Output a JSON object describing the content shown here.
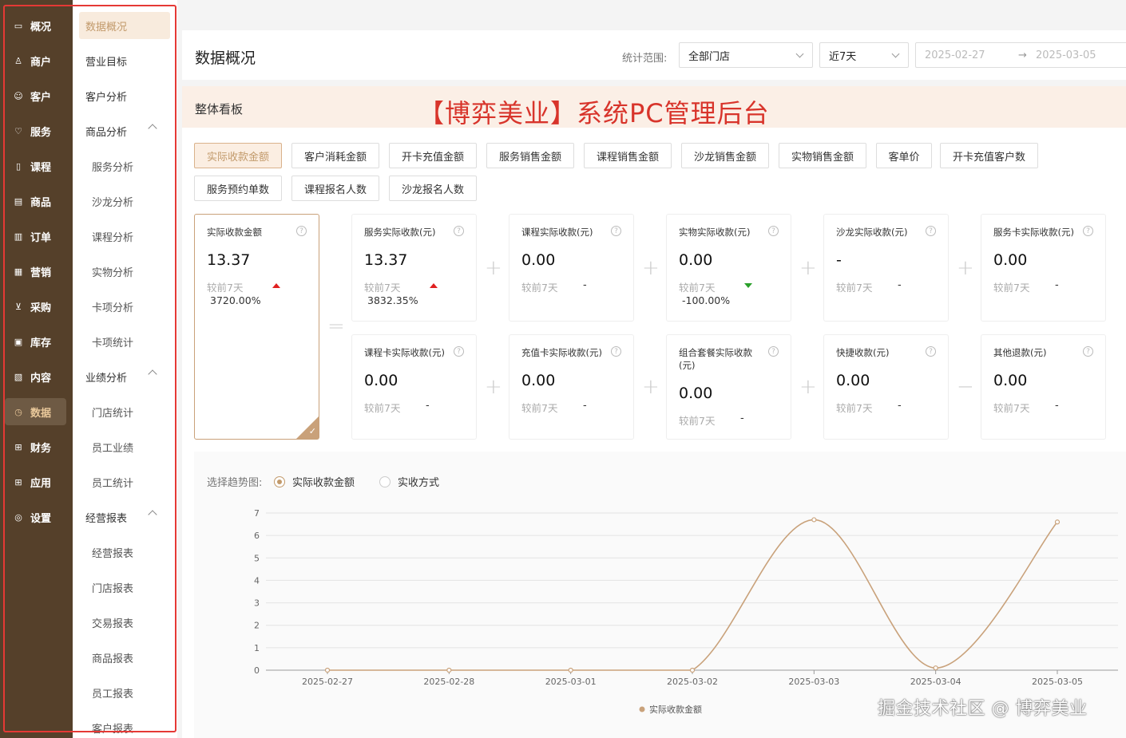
{
  "sidebar": {
    "items": [
      {
        "icon": "monitor-icon",
        "glyph": "▭",
        "label": "概况"
      },
      {
        "icon": "merchant-icon",
        "glyph": "♙",
        "label": "商户"
      },
      {
        "icon": "customer-icon",
        "glyph": "☺",
        "label": "客户"
      },
      {
        "icon": "service-icon",
        "glyph": "♡",
        "label": "服务"
      },
      {
        "icon": "course-icon",
        "glyph": "▯",
        "label": "课程"
      },
      {
        "icon": "product-icon",
        "glyph": "▤",
        "label": "商品"
      },
      {
        "icon": "order-icon",
        "glyph": "▥",
        "label": "订单"
      },
      {
        "icon": "marketing-icon",
        "glyph": "▦",
        "label": "营销"
      },
      {
        "icon": "cart-icon",
        "glyph": "⊻",
        "label": "采购"
      },
      {
        "icon": "inventory-icon",
        "glyph": "▣",
        "label": "库存"
      },
      {
        "icon": "image-icon",
        "glyph": "▧",
        "label": "内容"
      },
      {
        "icon": "clock-icon",
        "glyph": "◷",
        "label": "数据"
      },
      {
        "icon": "finance-icon",
        "glyph": "⊞",
        "label": "财务"
      },
      {
        "icon": "apps-icon",
        "glyph": "⊞",
        "label": "应用"
      },
      {
        "icon": "settings-icon",
        "glyph": "◎",
        "label": "设置"
      }
    ],
    "active_index": 11
  },
  "submenu": {
    "items": [
      {
        "label": "数据概况",
        "level": 1,
        "active": true
      },
      {
        "label": "营业目标",
        "level": 1
      },
      {
        "label": "客户分析",
        "level": 1
      },
      {
        "label": "商品分析",
        "level": 1,
        "expanded": true
      },
      {
        "label": "服务分析",
        "level": 2
      },
      {
        "label": "沙龙分析",
        "level": 2
      },
      {
        "label": "课程分析",
        "level": 2
      },
      {
        "label": "实物分析",
        "level": 2
      },
      {
        "label": "卡项分析",
        "level": 2
      },
      {
        "label": "卡项统计",
        "level": 2
      },
      {
        "label": "业绩分析",
        "level": 1,
        "expanded": true
      },
      {
        "label": "门店统计",
        "level": 2
      },
      {
        "label": "员工业绩",
        "level": 2
      },
      {
        "label": "员工统计",
        "level": 2
      },
      {
        "label": "经营报表",
        "level": 1,
        "expanded": true
      },
      {
        "label": "经营报表",
        "level": 2
      },
      {
        "label": "门店报表",
        "level": 2
      },
      {
        "label": "交易报表",
        "level": 2
      },
      {
        "label": "商品报表",
        "level": 2
      },
      {
        "label": "员工报表",
        "level": 2
      },
      {
        "label": "客户报表",
        "level": 2
      }
    ]
  },
  "header": {
    "title": "数据概况",
    "range_label": "统计范围:",
    "store_select": "全部门店",
    "period_select": "近7天",
    "date_start": "2025-02-27",
    "date_arrow": "→",
    "date_end": "2025-03-05"
  },
  "board": {
    "title": "整体看板",
    "banner": "【博弈美业】系统PC管理后台"
  },
  "tags": [
    {
      "label": "实际收款金额",
      "active": true
    },
    {
      "label": "客户消耗金额"
    },
    {
      "label": "开卡充值金额"
    },
    {
      "label": "服务销售金额"
    },
    {
      "label": "课程销售金额"
    },
    {
      "label": "沙龙销售金额"
    },
    {
      "label": "实物销售金额"
    },
    {
      "label": "客单价"
    },
    {
      "label": "开卡充值客户数"
    },
    {
      "label": "服务预约单数"
    },
    {
      "label": "课程报名人数"
    },
    {
      "label": "沙龙报名人数"
    }
  ],
  "main_card": {
    "title": "实际收款金额",
    "value": "13.37",
    "compare": "较前7天",
    "trend": "up",
    "percent": "3720.00%"
  },
  "cards_row1": [
    {
      "title": "服务实际收款(元)",
      "value": "13.37",
      "compare": "较前7天",
      "trend": "up",
      "percent": "3832.35%"
    },
    {
      "title": "课程实际收款(元)",
      "value": "0.00",
      "compare": "较前7天",
      "dash": "-"
    },
    {
      "title": "实物实际收款(元)",
      "value": "0.00",
      "compare": "较前7天",
      "trend": "down",
      "percent": "-100.00%"
    },
    {
      "title": "沙龙实际收款(元)",
      "value": "-",
      "compare": "较前7天",
      "dash": "-"
    },
    {
      "title": "服务卡实际收款(元)",
      "value": "0.00",
      "compare": "较前7天",
      "dash": "-"
    }
  ],
  "cards_row2": [
    {
      "title": "课程卡实际收款(元)",
      "value": "0.00",
      "compare": "较前7天",
      "dash": "-"
    },
    {
      "title": "充值卡实际收款(元)",
      "value": "0.00",
      "compare": "较前7天",
      "dash": "-"
    },
    {
      "title": "组合套餐实际收款(元)",
      "value": "0.00",
      "compare": "较前7天",
      "dash": "-"
    },
    {
      "title": "快捷收款(元)",
      "value": "0.00",
      "compare": "较前7天",
      "dash": "-"
    },
    {
      "title": "其他退款(元)",
      "value": "0.00",
      "compare": "较前7天",
      "dash": "-"
    }
  ],
  "operators": {
    "equals": "=",
    "plus": "+",
    "minus": "−",
    "help": "?"
  },
  "trend": {
    "label": "选择趋势图:",
    "options": [
      {
        "label": "实际收款金额",
        "checked": true
      },
      {
        "label": "实收方式"
      }
    ]
  },
  "chart_data": {
    "type": "line",
    "x": [
      "2025-02-27",
      "2025-02-28",
      "2025-03-01",
      "2025-03-02",
      "2025-03-03",
      "2025-03-04",
      "2025-03-05"
    ],
    "series": [
      {
        "name": "实际收款金额",
        "values": [
          0,
          0,
          0,
          0,
          6.7,
          0.1,
          6.6
        ]
      }
    ],
    "ylim": [
      0,
      7
    ],
    "yticks": [
      0,
      1,
      2,
      3,
      4,
      5,
      6,
      7
    ],
    "grid": true,
    "legend": "bottom",
    "color": "#c9a27b"
  },
  "watermark": "掘金技术社区 @ 博弈美业",
  "colors": {
    "sidebar_bg": "#55402a",
    "accent": "#c29a6b",
    "up": "#e02020",
    "down": "#2aa02a",
    "banner": "#d8342b"
  }
}
